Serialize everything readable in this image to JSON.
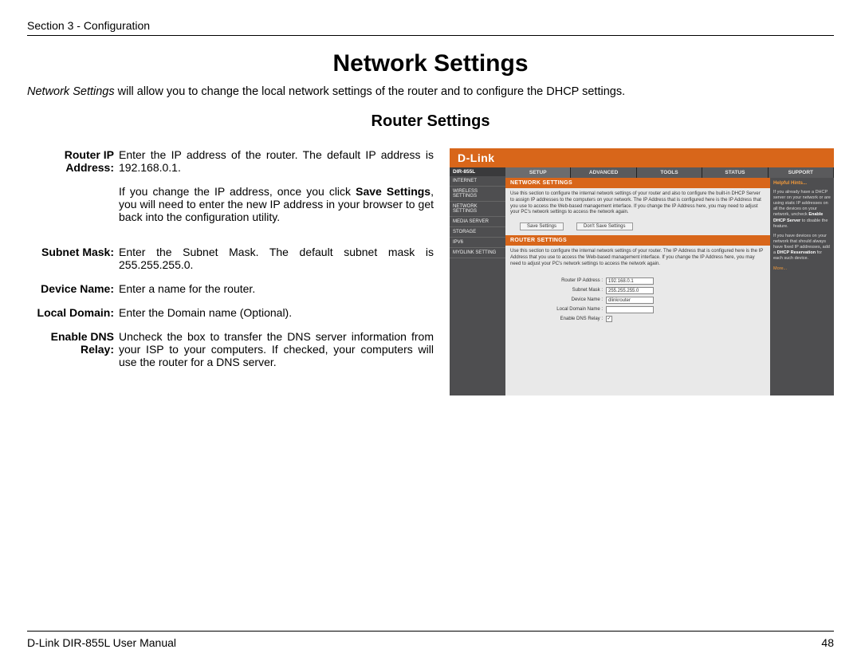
{
  "header": {
    "section": "Section 3 - Configuration"
  },
  "title": "Network Settings",
  "intro": {
    "emph": "Network Settings",
    "rest": " will allow you to change the local network settings of the router and to configure the DHCP settings."
  },
  "subtitle": "Router Settings",
  "defs": {
    "router_ip": {
      "label": "Router IP Address:",
      "p1": "Enter the IP address of the router. The default IP address is 192.168.0.1.",
      "p2a": "If you change the IP address, once you click ",
      "p2b": "Save Settings",
      "p2c": ", you will need to enter the new IP address in your browser to get back into the configuration utility."
    },
    "subnet": {
      "label": "Subnet Mask:",
      "body": "Enter the Subnet Mask. The default subnet mask is 255.255.255.0."
    },
    "device": {
      "label": "Device Name:",
      "body": "Enter a name for the router."
    },
    "domain": {
      "label": "Local Domain:",
      "body": "Enter the Domain name (Optional)."
    },
    "dns": {
      "label": "Enable DNS Relay:",
      "body": "Uncheck the box to transfer the DNS server information from your ISP to your computers. If checked, your computers will use the router for a DNS server."
    }
  },
  "shot": {
    "logo": "D-Link",
    "model": "DIR-855L",
    "nav": [
      "INTERNET",
      "WIRELESS SETTINGS",
      "NETWORK SETTINGS",
      "MEDIA SERVER",
      "STORAGE",
      "IPV6",
      "MYDLINK SETTING"
    ],
    "tabs": [
      "SETUP",
      "ADVANCED",
      "TOOLS",
      "STATUS",
      "SUPPORT"
    ],
    "section1": "NETWORK SETTINGS",
    "desc1": "Use this section to configure the internal network settings of your router and also to configure the built-in DHCP Server to assign IP addresses to the computers on your network. The IP Address that is configured here is the IP Address that you use to access the Web-based management interface. If you change the IP Address here, you may need to adjust your PC's network settings to access the network again.",
    "btn_save": "Save Settings",
    "btn_dont": "Don't Save Settings",
    "section2": "ROUTER SETTINGS",
    "desc2": "Use this section to configure the internal network settings of your router. The IP Address that is configured here is the IP Address that you use to access the Web-based management interface. If you change the IP Address here, you may need to adjust your PC's network settings to access the network again.",
    "form": {
      "ip_label": "Router IP Address :",
      "ip_val": "192.168.0.1",
      "mask_label": "Subnet Mask :",
      "mask_val": "255.255.255.0",
      "dev_label": "Device Name :",
      "dev_val": "dlinkrouter",
      "dom_label": "Local Domain Name :",
      "dom_val": "",
      "dns_label": "Enable DNS Relay :",
      "dns_check": "✓"
    },
    "hints": {
      "title": "Helpful Hints...",
      "t1a": "If you already have a DHCP server on your network or are using static IP addresses on all the devices on your network, uncheck ",
      "t1b": "Enable DHCP Server",
      "t1c": " to disable the feature.",
      "t2a": "If you have devices on your network that should always have fixed IP addresses, add a ",
      "t2b": "DHCP Reservation",
      "t2c": " for each such device.",
      "more": "More..."
    }
  },
  "footer": {
    "left": "D-Link DIR-855L User Manual",
    "right": "48"
  }
}
